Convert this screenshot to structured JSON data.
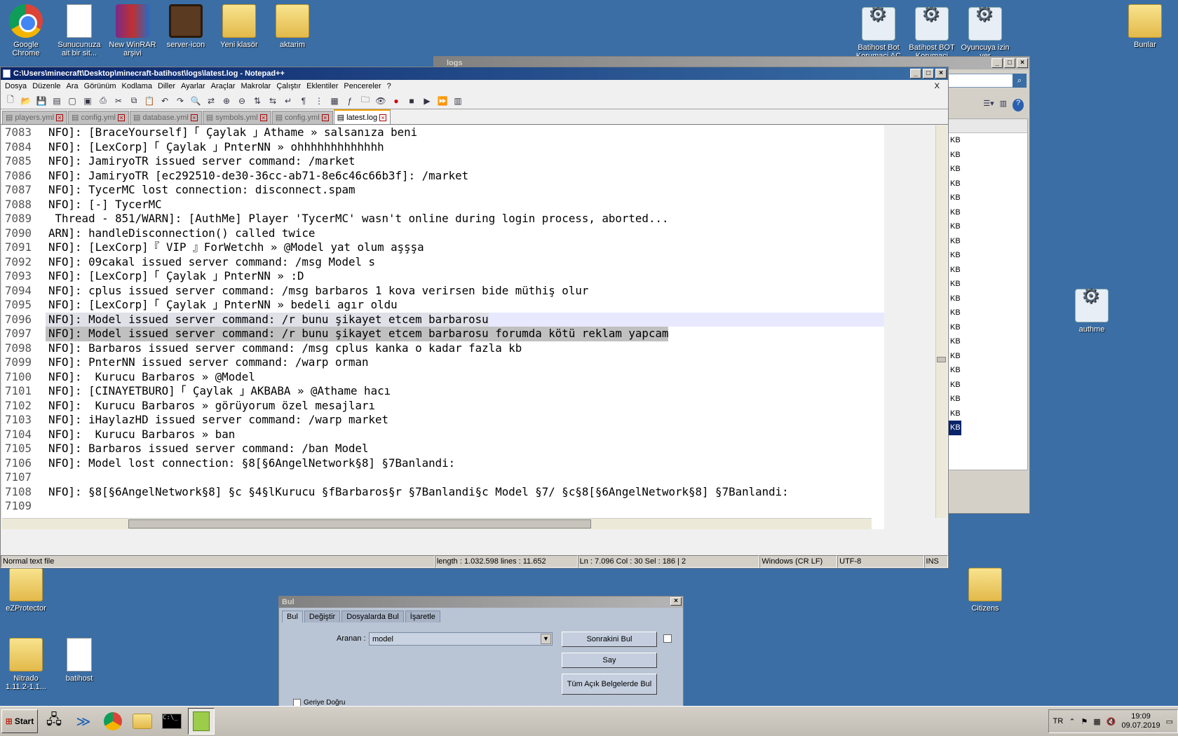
{
  "desktop": {
    "icons": [
      {
        "label": "Google\nChrome",
        "icon": "chrome-icon"
      },
      {
        "label": "Sunucunuza\nait bir sit...",
        "icon": "document-shortcut-icon"
      },
      {
        "label": "New WinRAR\narşivi",
        "icon": "winrar-icon"
      },
      {
        "label": "server-icon",
        "icon": "server-image-icon"
      },
      {
        "label": "Yeni klasör",
        "icon": "folder-icon"
      },
      {
        "label": "aktarim",
        "icon": "folder-icon"
      },
      {
        "label": "Batihost Bot\nKorumaci AC",
        "icon": "gear-document-icon"
      },
      {
        "label": "Batihost BOT\nKorumaci",
        "icon": "gear-document-icon"
      },
      {
        "label": "Oyuncuya izin\nver",
        "icon": "gear-document-icon"
      },
      {
        "label": "Bunlar",
        "icon": "folder-icon"
      },
      {
        "label": "authme",
        "icon": "gear-document-icon"
      },
      {
        "label": "eZProtector",
        "icon": "folder-icon"
      },
      {
        "label": "Citizens",
        "icon": "folder-icon"
      },
      {
        "label": "Nitrado\n1.11.2-1.1...",
        "icon": "folder-icon"
      },
      {
        "label": "batihost",
        "icon": "document-icon"
      }
    ]
  },
  "explorer": {
    "title": "logs",
    "sizes": [
      "KB",
      "KB",
      "KB",
      "KB",
      "KB",
      "KB",
      "KB",
      "KB",
      "KB",
      "KB",
      "KB",
      "KB",
      "KB",
      "KB",
      "KB",
      "KB",
      "KB",
      "KB",
      "KB",
      "KB",
      "KB"
    ]
  },
  "notepad": {
    "title": "C:\\Users\\minecraft\\Desktop\\minecraft-batihost\\logs\\latest.log - Notepad++",
    "menu": [
      "Dosya",
      "Düzenle",
      "Ara",
      "Görünüm",
      "Kodlama",
      "Diller",
      "Ayarlar",
      "Araçlar",
      "Makrolar",
      "Çalıştır",
      "Eklentiler",
      "Pencereler",
      "?"
    ],
    "close_doc": "X",
    "tabs": [
      {
        "label": "players.yml",
        "active": false
      },
      {
        "label": "config.yml",
        "active": false
      },
      {
        "label": "database.yml",
        "active": false
      },
      {
        "label": "symbols.yml",
        "active": false
      },
      {
        "label": "config.yml",
        "active": false
      },
      {
        "label": "latest.log",
        "active": true
      }
    ],
    "lines": [
      {
        "n": "7083",
        "t": "NFO]: [BraceYourself]「 Çaylak 」Athame » salsanıza beni"
      },
      {
        "n": "7084",
        "t": "NFO]: [LexCorp]「 Çaylak 」PnterNN » ohhhhhhhhhhhhh"
      },
      {
        "n": "7085",
        "t": "NFO]: JamiryoTR issued server command: /market"
      },
      {
        "n": "7086",
        "t": "NFO]: JamiryoTR [ec292510-de30-36cc-ab71-8e6c46c66b3f]: /market"
      },
      {
        "n": "7087",
        "t": "NFO]: TycerMC lost connection: disconnect.spam"
      },
      {
        "n": "7088",
        "t": "NFO]: [-] TycerMC"
      },
      {
        "n": "7089",
        "t": " Thread - 851/WARN]: [AuthMe] Player 'TycerMC' wasn't online during login process, aborted..."
      },
      {
        "n": "7090",
        "t": "ARN]: handleDisconnection() called twice"
      },
      {
        "n": "7091",
        "t": "NFO]: [LexCorp]『 VIP 』ForWetchh » @Model yat olum aşşşa"
      },
      {
        "n": "7092",
        "t": "NFO]: 09cakal issued server command: /msg Model s"
      },
      {
        "n": "7093",
        "t": "NFO]: [LexCorp]「 Çaylak 」PnterNN » :D"
      },
      {
        "n": "7094",
        "t": "NFO]: cplus issued server command: /msg barbaros 1 kova verirsen bide müthiş olur"
      },
      {
        "n": "7095",
        "t": "NFO]: [LexCorp]「 Çaylak 」PnterNN » bedeli agır oldu"
      },
      {
        "n": "7096",
        "t": "NFO]: Model issued server command: /r bunu şikayet etcem barbarosu",
        "state": "cur"
      },
      {
        "n": "7097",
        "t": "NFO]: Model issued server command: /r bunu şikayet etcem barbarosu forumda kötü reklam yapcam",
        "state": "sel"
      },
      {
        "n": "7098",
        "t": "NFO]: Barbaros issued server command: /msg cplus kanka o kadar fazla kb"
      },
      {
        "n": "7099",
        "t": "NFO]: PnterNN issued server command: /warp orman"
      },
      {
        "n": "7100",
        "t": "NFO]:  Kurucu Barbaros » @Model"
      },
      {
        "n": "7101",
        "t": "NFO]: [CINAYETBURO]「 Çaylak 」AKBABA » @Athame hacı"
      },
      {
        "n": "7102",
        "t": "NFO]:  Kurucu Barbaros » görüyorum özel mesajları"
      },
      {
        "n": "7103",
        "t": "NFO]: iHaylazHD issued server command: /warp market"
      },
      {
        "n": "7104",
        "t": "NFO]:  Kurucu Barbaros » ban"
      },
      {
        "n": "7105",
        "t": "NFO]: Barbaros issued server command: /ban Model"
      },
      {
        "n": "7106",
        "t": "NFO]: Model lost connection: §8[§6AngelNetwork§8] §7Banlandi:"
      },
      {
        "n": "7107",
        "t": ""
      },
      {
        "n": "7108",
        "t": "NFO]: §8[§6AngelNetwork§8] §c §4§lKurucu §fBarbaros§r §7Banlandi§c Model §7/ §c§8[§6AngelNetwork§8] §7Banlandi:"
      },
      {
        "n": "7109",
        "t": ""
      }
    ],
    "status": {
      "type": "Normal text file",
      "length": "length : 1.032.598    lines : 11.652",
      "pos": "Ln : 7.096    Col : 30    Sel : 186 | 2",
      "eol": "Windows (CR LF)",
      "enc": "UTF-8",
      "mode": "INS"
    }
  },
  "find": {
    "title": "Bul",
    "tabs": [
      "Bul",
      "Değiştir",
      "Dosyalarda Bul",
      "İşaretle"
    ],
    "label": "Aranan :",
    "value": "model",
    "btn_next": "Sonrakini Bul",
    "btn_count": "Say",
    "btn_all": "Tüm Açık Belgelerde Bul",
    "backward": "Geriye Doğru"
  },
  "taskbar": {
    "start": "Start",
    "lang": "TR",
    "time": "19:09",
    "date": "09.07.2019"
  }
}
